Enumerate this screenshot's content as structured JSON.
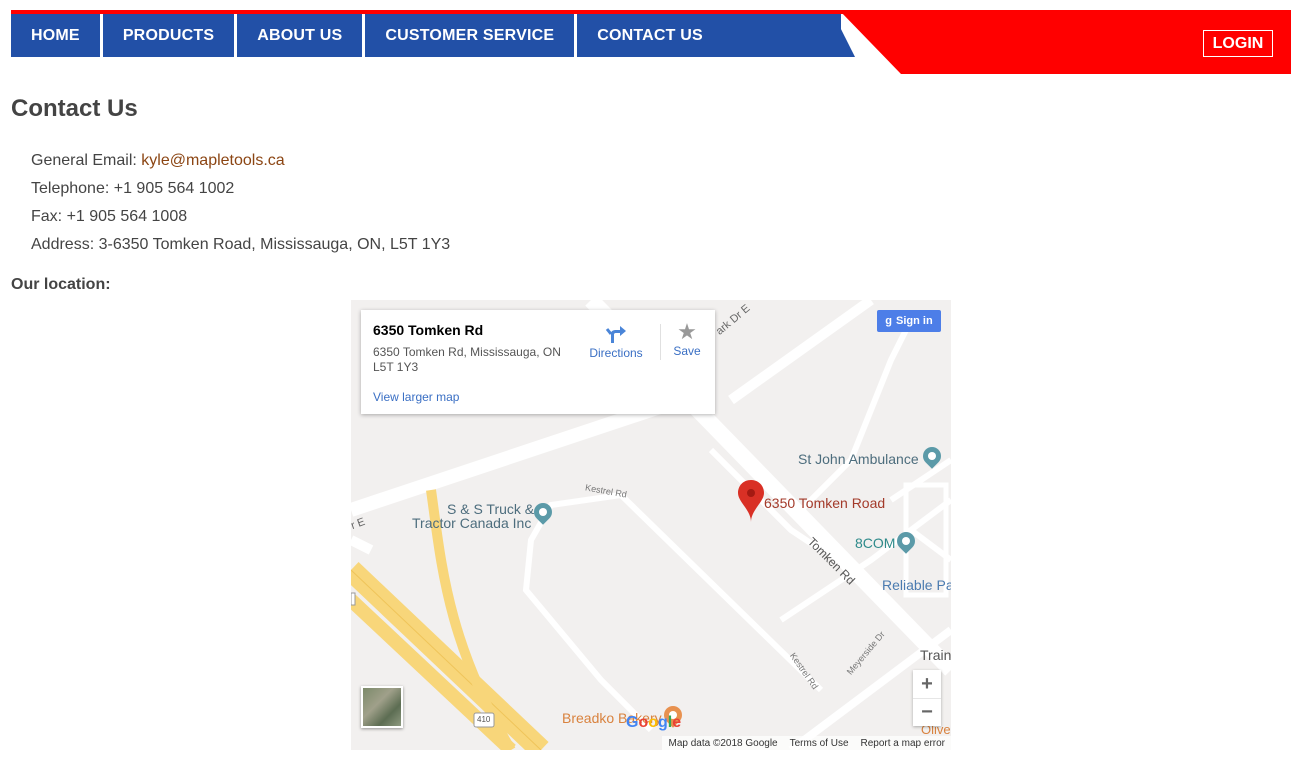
{
  "nav": {
    "items": [
      {
        "label": "HOME"
      },
      {
        "label": "PRODUCTS"
      },
      {
        "label": "ABOUT US"
      },
      {
        "label": "CUSTOMER SERVICE"
      },
      {
        "label": "CONTACT US"
      }
    ],
    "login_label": "LOGIN"
  },
  "page": {
    "title": "Contact Us",
    "email_label": "General Email:",
    "email": "kyle@mapletools.ca",
    "telephone": "Telephone: +1 905 564 1002",
    "fax": "Fax: +1 905 564 1008",
    "address": "Address: 3-6350 Tomken Road, Mississauga, ON, L5T 1Y3",
    "location_label": "Our location:"
  },
  "map": {
    "card_title": "6350 Tomken Rd",
    "card_address": "6350 Tomken Rd, Mississauga, ON L5T 1Y3",
    "directions_label": "Directions",
    "save_label": "Save",
    "view_larger": "View larger map",
    "signin_label": "Sign in",
    "zoom_in": "+",
    "zoom_out": "−",
    "marker_label": "6350 Tomken Road",
    "places": {
      "st_john": "St John Ambulance",
      "truck_line1": "S & S Truck &",
      "truck_line2": "Tractor Canada Inc",
      "com8": "8COM",
      "reliable": "Reliable Pa",
      "train": "Train",
      "breadko": "Breadko Bakery",
      "olive": "Olive"
    },
    "road_labels": {
      "kestrel_top": "Kestrel Rd",
      "kestrel_bottom": "Kestrel Rd",
      "tomken": "Tomken Rd",
      "meyerside": "Meyerside Dr",
      "park": "ark Dr E",
      "dr_e": "r E",
      "hwy": "410"
    },
    "attribution": {
      "data": "Map data ©2018 Google",
      "terms": "Terms of Use",
      "report": "Report a map error"
    },
    "colors": {
      "marker": "#d93025",
      "poi_teal": "#5b9aa8",
      "poi_food": "#e8914f"
    }
  }
}
